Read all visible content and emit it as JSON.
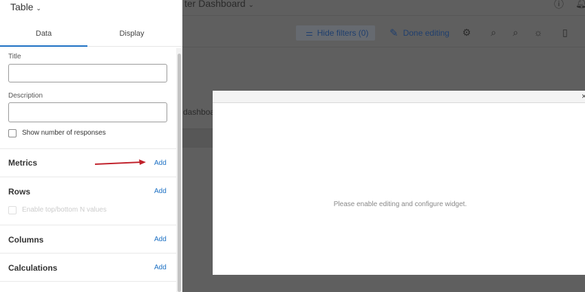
{
  "dashboard": {
    "title": "ter Dashboard",
    "hide_filters": "Hide filters (0)",
    "done_editing": "Done editing",
    "partial_text": "dashboard"
  },
  "modal": {
    "message": "Please enable editing and configure widget.",
    "close": "×"
  },
  "panel": {
    "widget_type": "Table",
    "tabs": [
      {
        "label": "Data"
      },
      {
        "label": "Display"
      }
    ],
    "title_label": "Title",
    "description_label": "Description",
    "show_responses": "Show number of responses",
    "sections": [
      {
        "name": "Metrics",
        "add": "Add"
      },
      {
        "name": "Rows",
        "add": "Add"
      },
      {
        "name": "Columns",
        "add": "Add"
      },
      {
        "name": "Calculations",
        "add": "Add"
      }
    ],
    "enable_topn": "Enable top/bottom N values"
  },
  "colors": {
    "accent": "#1a6fc3",
    "arrow": "#c0202a"
  }
}
